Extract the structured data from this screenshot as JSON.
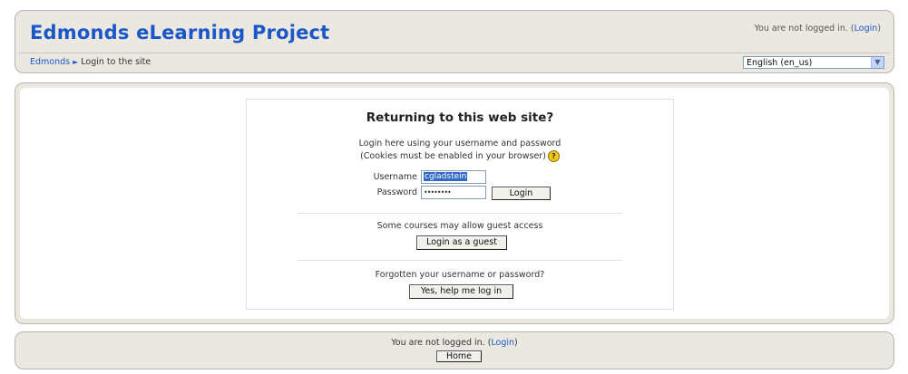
{
  "header": {
    "site_title": "Edmonds eLearning Project",
    "login_status_text": "You are not logged in. (",
    "login_link": "Login",
    "login_status_close": ")",
    "breadcrumb": {
      "home": "Edmonds",
      "separator": "►",
      "current": "Login to the site"
    },
    "language_select": {
      "value": "English (en_us)"
    }
  },
  "login": {
    "heading": "Returning to this web site?",
    "instructions_line1": "Login here using your username and password",
    "instructions_line2": "(Cookies must be enabled in your browser)",
    "help_icon_glyph": "?",
    "username_label": "Username",
    "username_value": "cgladstein",
    "password_label": "Password",
    "password_value": "••••••••",
    "login_button": "Login",
    "guest_text": "Some courses may allow guest access",
    "guest_button": "Login as a guest",
    "forgot_text": "Forgotten your username or password?",
    "forgot_button": "Yes, help me log in"
  },
  "footer": {
    "status_text": "You are not logged in. (",
    "login_link": "Login",
    "status_close": ")",
    "home_button": "Home"
  },
  "colors": {
    "title_blue": "#1b57c9",
    "panel_bg": "#ebe8e1",
    "selection": "#3169c6"
  },
  "icons": {
    "breadcrumb_separator": "arrow-right-icon",
    "help": "help-icon",
    "dropdown": "chevron-down-icon"
  }
}
